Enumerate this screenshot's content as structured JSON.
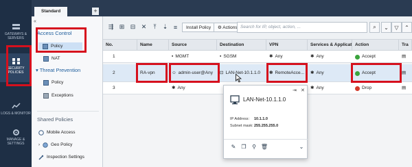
{
  "rail": {
    "items": [
      {
        "label": "GATEWAYS & SERVERS",
        "icon": "gateways-icon"
      },
      {
        "label": "SECURITY POLICIES",
        "icon": "security-policies-icon"
      },
      {
        "label": "LOGS & MONITOR",
        "icon": "logs-monitor-icon"
      },
      {
        "label": "MANAGE & SETTINGS",
        "icon": "manage-settings-icon"
      }
    ]
  },
  "tabs": {
    "active": "Standard",
    "add": "+"
  },
  "tree": {
    "collapse": "«",
    "access_control": "Access Control",
    "policy": "Policy",
    "nat": "NAT",
    "threat_prevention": "Threat Prevention",
    "tp_policy": "Policy",
    "exceptions": "Exceptions",
    "shared_policies": "Shared Policies",
    "mobile_access": "Mobile Access",
    "geo_policy": "Geo Policy",
    "inspection_settings": "Inspection Settings"
  },
  "toolbar": {
    "install_policy": "Install Policy",
    "actions": "Actions",
    "search_placeholder": "Search for IP, object, action, ..."
  },
  "table": {
    "headers": [
      "No.",
      "Name",
      "Source",
      "Destination",
      "VPN",
      "Services & Applicati...",
      "Action",
      "Tra"
    ],
    "rows": [
      {
        "no": "1",
        "name": "",
        "source": "MGMT",
        "destination": "SGSM",
        "vpn": "Any",
        "services": "Any",
        "action": "Accept"
      },
      {
        "no": "2",
        "name": "RA-vpn",
        "source": "admin-user@Any",
        "destination": "LAN-Net-10.1.1.0",
        "vpn": "RemoteAcce...",
        "services": "Any",
        "action": "Accept"
      },
      {
        "no": "3",
        "name": "",
        "source": "Any",
        "destination": "",
        "vpn": "",
        "services": "Any",
        "action": "Drop"
      }
    ]
  },
  "popup": {
    "title": "LAN-Net-10.1.1.0",
    "ip_label": "IP Address:",
    "ip_value": "10.1.1.0",
    "mask_label": "Subnet mask:",
    "mask_value": "255.255.255.0"
  },
  "colors": {
    "highlight": "#d6101d",
    "accept": "#3aa33c",
    "drop": "#d33a2c",
    "rail": "#1e2f45"
  }
}
